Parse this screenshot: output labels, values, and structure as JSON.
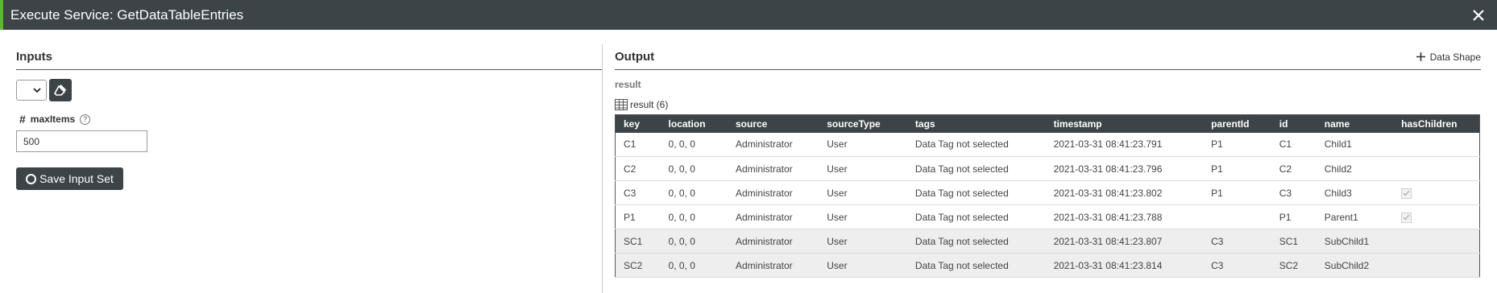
{
  "window": {
    "title": "Execute Service: GetDataTableEntries",
    "accent_color": "#5cb82e",
    "bar_color": "#3c4448"
  },
  "inputs": {
    "header": "Inputs",
    "field_label": "maxItems",
    "field_value": "500",
    "save_label": "Save Input Set"
  },
  "output": {
    "header": "Output",
    "data_shape_label": "Data Shape",
    "result_label": "result",
    "result_count": "result (6)",
    "columns": [
      "key",
      "location",
      "source",
      "sourceType",
      "tags",
      "timestamp",
      "parentId",
      "id",
      "name",
      "hasChildren"
    ],
    "rows": [
      {
        "key": "C1",
        "location": "0, 0, 0",
        "source": "Administrator",
        "sourceType": "User",
        "tags": "Data Tag not selected",
        "timestamp": "2021-03-31 08:41:23.791",
        "parentId": "P1",
        "id": "C1",
        "name": "Child1",
        "hasChildren": false
      },
      {
        "key": "C2",
        "location": "0, 0, 0",
        "source": "Administrator",
        "sourceType": "User",
        "tags": "Data Tag not selected",
        "timestamp": "2021-03-31 08:41:23.796",
        "parentId": "P1",
        "id": "C2",
        "name": "Child2",
        "hasChildren": false
      },
      {
        "key": "C3",
        "location": "0, 0, 0",
        "source": "Administrator",
        "sourceType": "User",
        "tags": "Data Tag not selected",
        "timestamp": "2021-03-31 08:41:23.802",
        "parentId": "P1",
        "id": "C3",
        "name": "Child3",
        "hasChildren": true
      },
      {
        "key": "P1",
        "location": "0, 0, 0",
        "source": "Administrator",
        "sourceType": "User",
        "tags": "Data Tag not selected",
        "timestamp": "2021-03-31 08:41:23.788",
        "parentId": "",
        "id": "P1",
        "name": "Parent1",
        "hasChildren": true
      },
      {
        "key": "SC1",
        "location": "0, 0, 0",
        "source": "Administrator",
        "sourceType": "User",
        "tags": "Data Tag not selected",
        "timestamp": "2021-03-31 08:41:23.807",
        "parentId": "C3",
        "id": "SC1",
        "name": "SubChild1",
        "hasChildren": false
      },
      {
        "key": "SC2",
        "location": "0, 0, 0",
        "source": "Administrator",
        "sourceType": "User",
        "tags": "Data Tag not selected",
        "timestamp": "2021-03-31 08:41:23.814",
        "parentId": "C3",
        "id": "SC2",
        "name": "SubChild2",
        "hasChildren": false
      }
    ]
  }
}
